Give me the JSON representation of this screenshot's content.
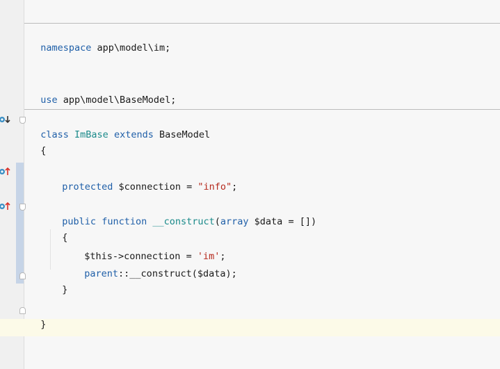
{
  "code": {
    "namespace_kw": "namespace",
    "namespace_path": " app\\model\\im;",
    "use_kw": "use",
    "use_path": " app\\model\\BaseModel;",
    "class_kw": "class",
    "class_name": "ImBase",
    "extends_kw": "extends",
    "parent_class": "BaseModel",
    "open_brace": "{",
    "protected_kw": "protected",
    "prop_name": " $connection = ",
    "prop_value": "\"info\"",
    "semicolon": ";",
    "public_kw": "public",
    "function_kw": "function",
    "method_name": "__construct",
    "paren_open": "(",
    "array_kw": "array",
    "param": " $data = [])",
    "method_open_brace": "{",
    "this_assign": "$this->connection = ",
    "assign_value": "'im'",
    "parent_kw": "parent",
    "parent_call": "::__construct($data);",
    "method_close_brace": "}",
    "close_brace": "}"
  },
  "colors": {
    "keyword": "#1f5fa8",
    "class_name": "#1a8a8a",
    "string": "#b52a1d",
    "current_line": "#fcfae8"
  }
}
